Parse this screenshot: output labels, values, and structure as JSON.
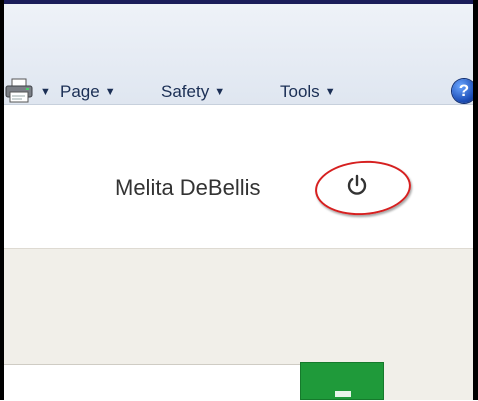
{
  "commandbar": {
    "items": [
      {
        "label": "Page"
      },
      {
        "label": "Safety"
      },
      {
        "label": "Tools"
      }
    ],
    "dropdown_glyph": "▼",
    "icons": [
      "printer-icon",
      "help-icon"
    ],
    "help_glyph": "?"
  },
  "header": {
    "user_name": "Melita DeBellis",
    "logout_icon": "power-icon",
    "annotation_color": "#d62020"
  },
  "search": {
    "value": "",
    "submit_color": "#1f9a3a",
    "submit_icon": "arrow-right-icon"
  }
}
